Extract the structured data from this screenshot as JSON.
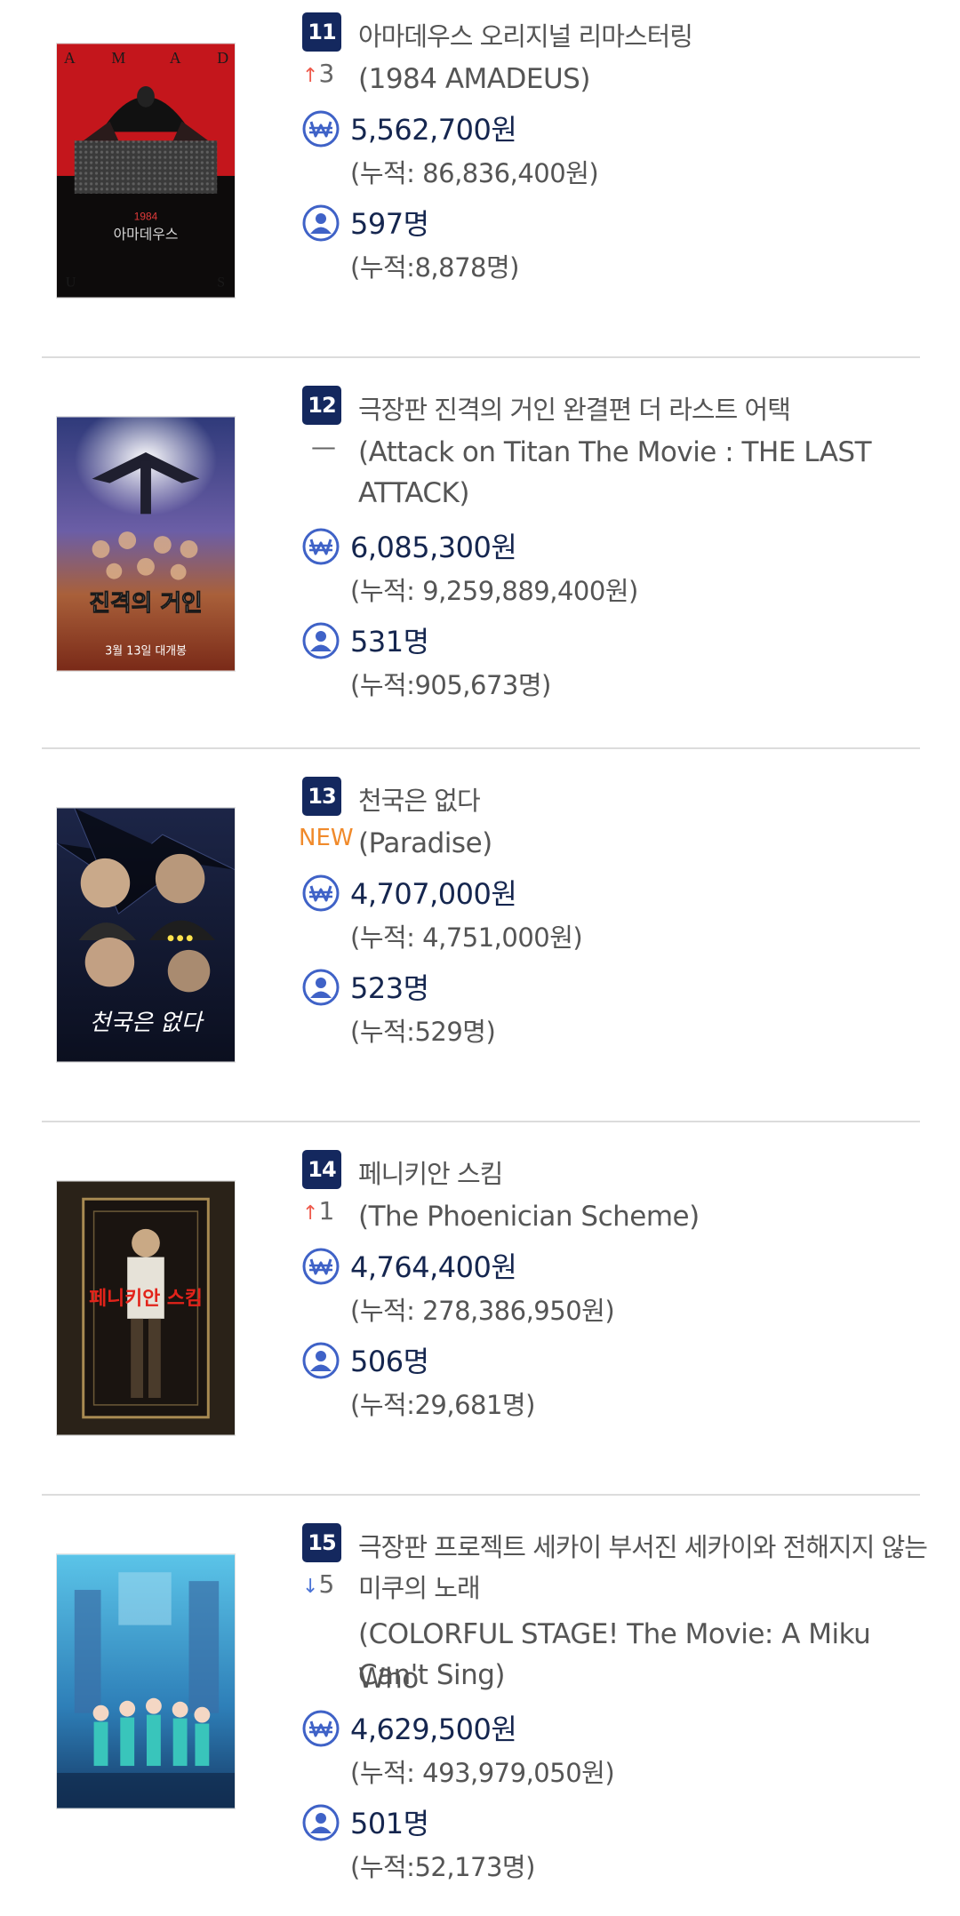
{
  "icons": {
    "money": "won-coin-icon",
    "audience": "person-icon",
    "up": "arrow-up-icon",
    "down": "arrow-down-icon"
  },
  "colors": {
    "badge": "#14285e",
    "up": "#ee5a4c",
    "down": "#4c74d6",
    "new": "#f08a2b",
    "icon": "#3f62c7"
  },
  "entries": [
    {
      "rank": "11",
      "title_ko": "아마데우스 오리지널 리마스터링",
      "change_type": "up",
      "change_arrow": "↑",
      "change_value": "3",
      "title_en": "(1984 AMADEUS)",
      "sales": "5,562,700원",
      "sales_total": "(누적: 86,836,400원)",
      "audience": "597명",
      "audience_total": "(누적:8,878명)",
      "poster_text": "아마데우스"
    },
    {
      "rank": "12",
      "title_ko": "극장판 진격의 거인 완결편 더 라스트 어택",
      "change_type": "same",
      "change_arrow": "",
      "change_value": "—",
      "title_en": "(Attack on Titan The Movie : THE LAST",
      "title_en_2": "ATTACK)",
      "sales": "6,085,300원",
      "sales_total": "(누적: 9,259,889,400원)",
      "audience": "531명",
      "audience_total": "(누적:905,673명)",
      "poster_text": "진격의 거인",
      "poster_subtext": "3월 13일 대개봉"
    },
    {
      "rank": "13",
      "title_ko": "천국은 없다",
      "change_type": "new",
      "change_arrow": "",
      "change_value": "NEW",
      "title_en": "(Paradise)",
      "sales": "4,707,000원",
      "sales_total": "(누적: 4,751,000원)",
      "audience": "523명",
      "audience_total": "(누적:529명)",
      "poster_text": "천국은 없다"
    },
    {
      "rank": "14",
      "title_ko": "페니키안 스킴",
      "change_type": "up",
      "change_arrow": "↑",
      "change_value": "1",
      "title_en": "(The Phoenician Scheme)",
      "sales": "4,764,400원",
      "sales_total": "(누적: 278,386,950원)",
      "audience": "506명",
      "audience_total": "(누적:29,681명)",
      "poster_text": "페니키안 스킴"
    },
    {
      "rank": "15",
      "title_ko": "극장판 프로젝트 세카이 부서진 세카이와 전해지지 않는",
      "title_ko_2": "미쿠의 노래",
      "change_type": "down",
      "change_arrow": "↓",
      "change_value": "5",
      "title_en": "(COLORFUL STAGE! The Movie: A Miku Who",
      "title_en_2": "Can't Sing)",
      "sales": "4,629,500원",
      "sales_total": "(누적: 493,979,050원)",
      "audience": "501명",
      "audience_total": "(누적:52,173명)"
    }
  ]
}
